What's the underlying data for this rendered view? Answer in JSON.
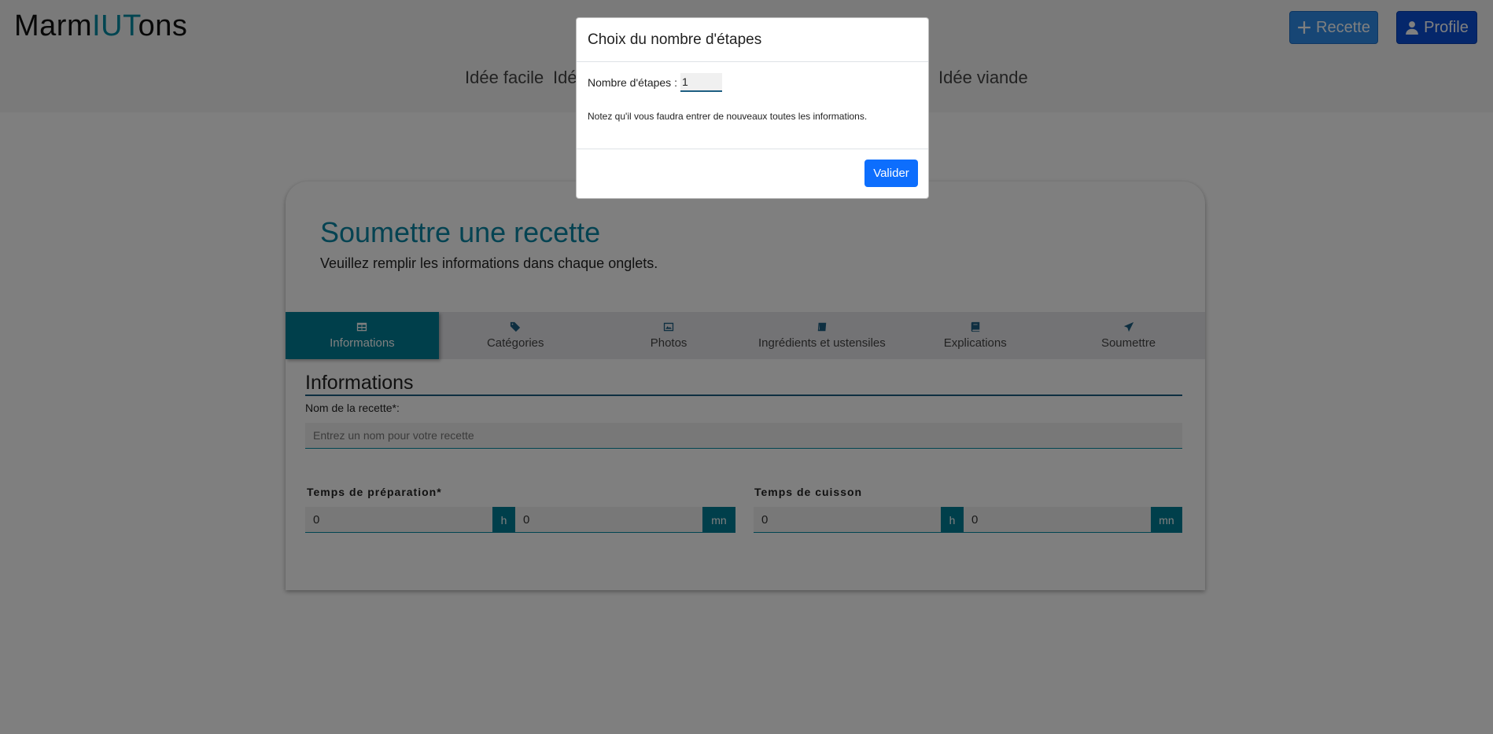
{
  "header": {
    "brand_part1": "Marm",
    "brand_part2": "IUT",
    "brand_part3": "ons",
    "recette_button": "Recette",
    "profile_button": "Profile"
  },
  "nav": {
    "items": [
      "Idée facile",
      "Idé",
      "Idée viande"
    ]
  },
  "card": {
    "title": "Soumettre une recette",
    "subtitle": "Veuillez remplir les informations dans chaque onglets."
  },
  "tabs": [
    {
      "label": "Informations",
      "icon": "table-icon",
      "active": true
    },
    {
      "label": "Catégories",
      "icon": "tags-icon",
      "active": false
    },
    {
      "label": "Photos",
      "icon": "image-icon",
      "active": false
    },
    {
      "label": "Ingrédients et ustensiles",
      "icon": "box-icon",
      "active": false
    },
    {
      "label": "Explications",
      "icon": "book-icon",
      "active": false
    },
    {
      "label": "Soumettre",
      "icon": "paper-plane-icon",
      "active": false
    }
  ],
  "form": {
    "section_title": "Informations",
    "name_label": "Nom de la recette*:",
    "name_placeholder": "Entrez un nom pour votre recette",
    "prep_label": "Temps de préparation*",
    "prep_hours": "0",
    "prep_minutes": "0",
    "cook_label": "Temps de cuisson",
    "cook_hours": "0",
    "cook_minutes": "0",
    "unit_hours": "h",
    "unit_minutes": "mn"
  },
  "modal": {
    "title": "Choix du nombre d'étapes",
    "steps_label": "Nombre d'étapes :",
    "steps_value": "1",
    "note": "Notez qu'il vous faudra entrer de nouveaux toutes les informations.",
    "submit_label": "Valider"
  },
  "colors": {
    "accent": "#008ba3",
    "tab_active": "#007f96",
    "primary_button": "#0d6efd"
  }
}
